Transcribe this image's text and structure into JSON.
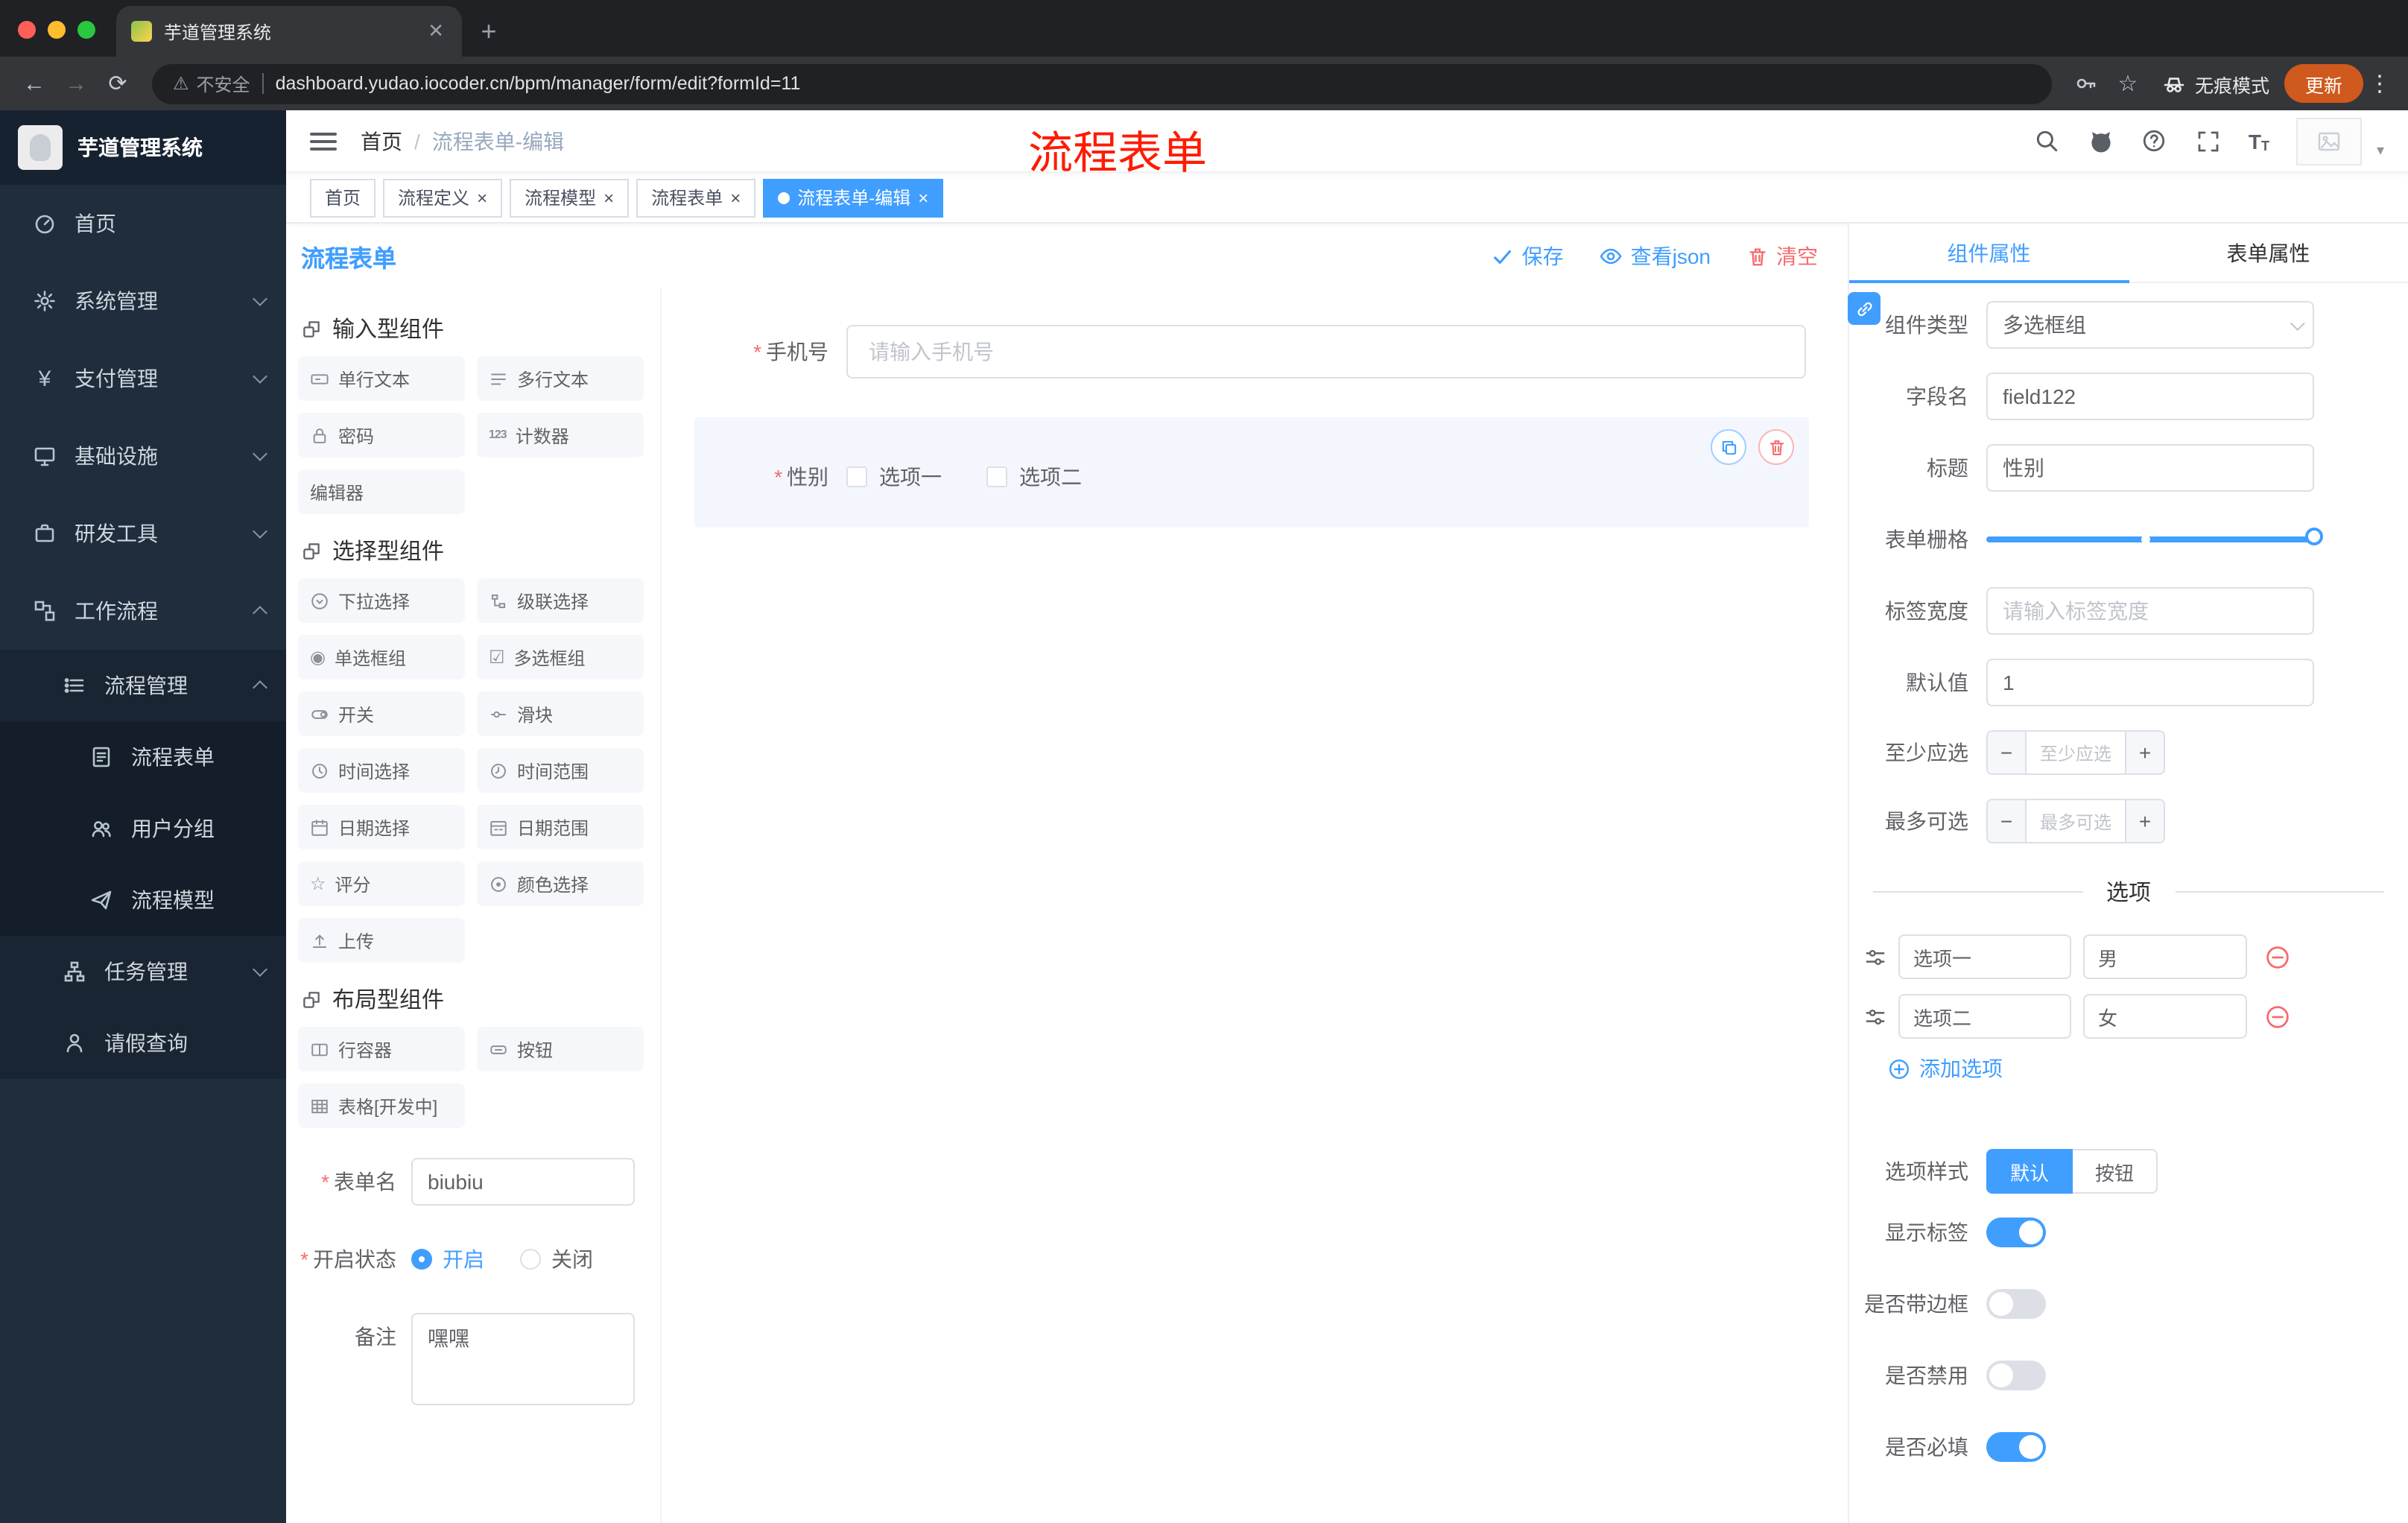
{
  "colors": {
    "accent": "#409eff",
    "danger": "#f56c6c",
    "annotation_red": "#fe1b00",
    "sidebar_bg": "#1f2d3d",
    "chrome_bg": "#202124",
    "update_button_bg": "#d0591d",
    "active_tag_bg": "#409eff"
  },
  "browser": {
    "tab_title": "芋道管理系统",
    "security_label": "不安全",
    "url": "dashboard.yudao.iocoder.cn/bpm/manager/form/edit?formId=11",
    "incognito_label": "无痕模式",
    "update_label": "更新"
  },
  "sidebar": {
    "logo_title": "芋道管理系统",
    "items": [
      {
        "label": "首页"
      },
      {
        "label": "系统管理"
      },
      {
        "label": "支付管理"
      },
      {
        "label": "基础设施"
      },
      {
        "label": "研发工具"
      },
      {
        "label": "工作流程"
      },
      {
        "label": "流程管理"
      },
      {
        "label": "流程表单"
      },
      {
        "label": "用户分组"
      },
      {
        "label": "流程模型"
      },
      {
        "label": "任务管理"
      },
      {
        "label": "请假查询"
      }
    ]
  },
  "navbar": {
    "breadcrumb_home": "首页",
    "breadcrumb_sep": "/",
    "breadcrumb_current": "流程表单-编辑",
    "annotation": "流程表单"
  },
  "tags": [
    {
      "label": "首页"
    },
    {
      "label": "流程定义"
    },
    {
      "label": "流程模型"
    },
    {
      "label": "流程表单"
    },
    {
      "label": "流程表单-编辑"
    }
  ],
  "designer": {
    "title": "流程表单",
    "save": "保存",
    "view_json": "查看json",
    "clear": "清空",
    "sections": [
      {
        "title": "输入型组件"
      },
      {
        "title": "选择型组件"
      },
      {
        "title": "布局型组件"
      }
    ],
    "components": {
      "input": [
        "单行文本",
        "多行文本",
        "密码",
        "计数器",
        "编辑器"
      ],
      "select": [
        "下拉选择",
        "级联选择",
        "单选框组",
        "多选框组",
        "开关",
        "滑块",
        "时间选择",
        "时间范围",
        "日期选择",
        "日期范围",
        "评分",
        "颜色选择",
        "上传"
      ],
      "layout": [
        "行容器",
        "按钮",
        "表格[开发中]"
      ]
    },
    "meta": {
      "name_label": "表单名",
      "name_value": "biubiu",
      "status_label": "开启状态",
      "status_on": "开启",
      "status_off": "关闭",
      "remark_label": "备注",
      "remark_value": "嘿嘿"
    },
    "canvas": {
      "phone_label": "手机号",
      "phone_placeholder": "请输入手机号",
      "gender_label": "性别",
      "gender_options": [
        "选项一",
        "选项二"
      ]
    }
  },
  "props": {
    "tab_component": "组件属性",
    "tab_form": "表单属性",
    "component_type_label": "组件类型",
    "component_type_value": "多选框组",
    "field_label": "字段名",
    "field_value": "field122",
    "title_label": "标题",
    "title_value": "性别",
    "grid_label": "表单栅格",
    "label_width_label": "标签宽度",
    "label_width_placeholder": "请输入标签宽度",
    "default_label": "默认值",
    "default_value": "1",
    "min_label": "至少应选",
    "min_placeholder": "至少应选",
    "max_label": "最多可选",
    "max_placeholder": "最多可选",
    "options_title": "选项",
    "options": [
      {
        "label": "选项一",
        "value": "男"
      },
      {
        "label": "选项二",
        "value": "女"
      }
    ],
    "add_option": "添加选项",
    "style_label": "选项样式",
    "style_default": "默认",
    "style_button": "按钮",
    "show_label": "显示标签",
    "border_label": "是否带边框",
    "disabled_label": "是否禁用",
    "required_label": "是否必填"
  }
}
